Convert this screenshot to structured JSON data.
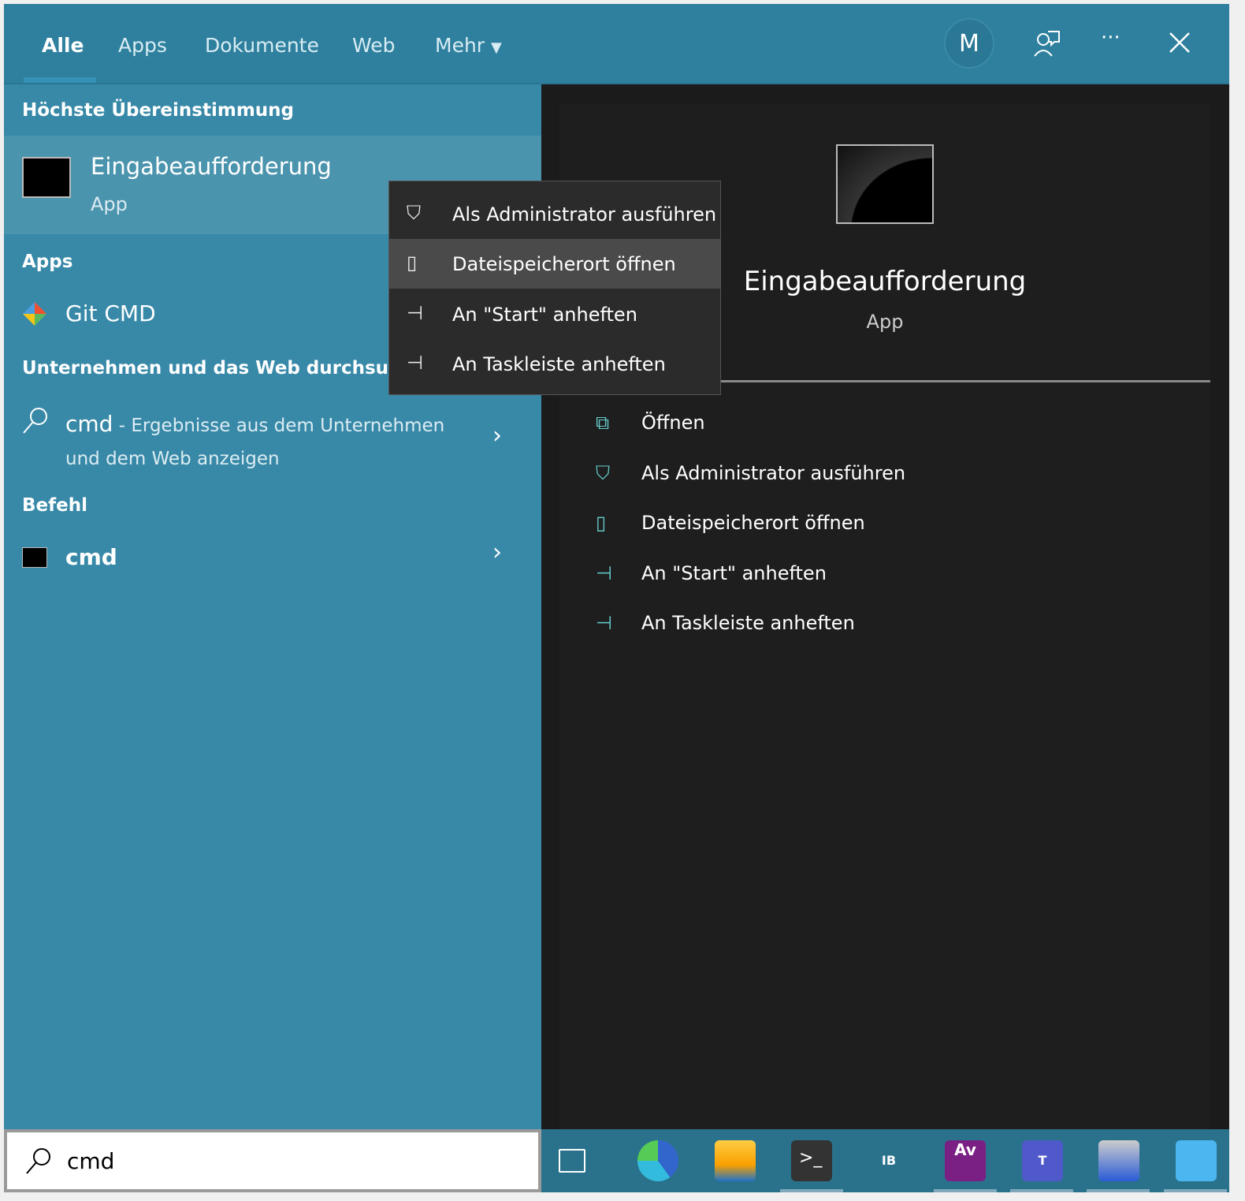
{
  "tabs": [
    {
      "label": "Alle",
      "active": true
    },
    {
      "label": "Apps"
    },
    {
      "label": "Dokumente"
    },
    {
      "label": "Web"
    },
    {
      "label": "Mehr"
    }
  ],
  "header": {
    "avatar": "M",
    "icons": [
      "feedback-icon",
      "more-icon",
      "close-icon"
    ]
  },
  "left": {
    "best_match_heading": "Höchste Übereinstimmung",
    "best_match": {
      "title": "Eingabeaufforderung",
      "subtitle": "App"
    },
    "apps_heading": "Apps",
    "apps": [
      {
        "label": "Git CMD"
      }
    ],
    "web_heading": "Unternehmen und das Web durchsuchen",
    "web_result": {
      "query": "cmd",
      "separator": " - ",
      "desc1": "Ergebnisse aus dem Unternehmen",
      "desc2": "und dem Web anzeigen"
    },
    "command_heading": "Befehl",
    "command": {
      "label": "cmd"
    }
  },
  "context_menu": [
    {
      "label": "Als Administrator ausführen",
      "icon": "shield-icon"
    },
    {
      "label": "Dateispeicherort öffnen",
      "icon": "folder-icon",
      "hover": true
    },
    {
      "label": "An \"Start\" anheften",
      "icon": "pin-icon"
    },
    {
      "label": "An Taskleiste anheften",
      "icon": "pin-icon"
    }
  ],
  "preview": {
    "title": "Eingabeaufforderung",
    "subtitle": "App",
    "actions": [
      {
        "label": "Öffnen",
        "icon": "open-icon"
      },
      {
        "label": "Als Administrator ausführen",
        "icon": "shield-icon"
      },
      {
        "label": "Dateispeicherort öffnen",
        "icon": "folder-icon"
      },
      {
        "label": "An \"Start\" anheften",
        "icon": "pin-icon"
      },
      {
        "label": "An Taskleiste anheften",
        "icon": "pin-icon"
      }
    ]
  },
  "search": {
    "value": "cmd"
  },
  "taskbar": [
    "task-view",
    "edge",
    "file-explorer",
    "terminal",
    "ib-app",
    "av-erp",
    "teams",
    "remote-desktop",
    "search-app"
  ],
  "colors": {
    "header": "#2e809e",
    "left_panel": "#3889a8",
    "right_panel": "#1b1b1b",
    "taskbar": "#2a728c"
  }
}
